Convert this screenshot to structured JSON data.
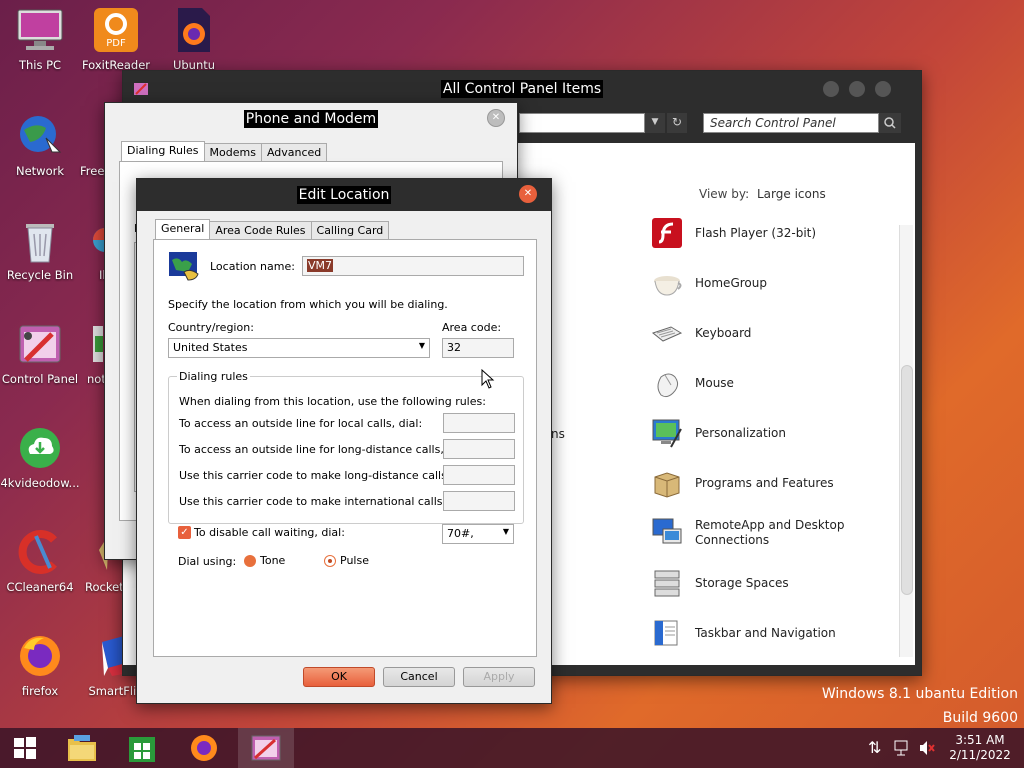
{
  "desktop_icons": [
    {
      "label": "This PC",
      "icon": "computer-icon"
    },
    {
      "label": "FoxitReader",
      "icon": "pdf-icon"
    },
    {
      "label": "Ubuntu",
      "icon": "firefox-file-icon"
    },
    {
      "label": "Network",
      "icon": "globe-icon"
    },
    {
      "label": "Free",
      "icon": "app-icon"
    },
    {
      "label": "Recycle Bin",
      "icon": "recycle-bin-icon"
    },
    {
      "label": "Il",
      "icon": "app-icon"
    },
    {
      "label": "Control Panel",
      "icon": "control-panel-icon"
    },
    {
      "label": "not",
      "icon": "app-icon"
    },
    {
      "label": "4kvideodow...",
      "icon": "download-icon"
    },
    {
      "label": "CCleaner64",
      "icon": "ccleaner-icon"
    },
    {
      "label": "Rocket",
      "icon": "app-icon"
    },
    {
      "label": "firefox",
      "icon": "firefox-icon"
    },
    {
      "label": "SmartFlip",
      "icon": "smartflip-icon"
    }
  ],
  "control_panel": {
    "title": "All Control Panel Items",
    "search_placeholder": "Search Control Panel",
    "view_by_label": "View by:",
    "view_by_value": "Large icons",
    "partial_text": "ns",
    "items": [
      {
        "label": "Flash Player (32-bit)",
        "icon": "flash-icon"
      },
      {
        "label": "HomeGroup",
        "icon": "homegroup-icon"
      },
      {
        "label": "Keyboard",
        "icon": "keyboard-icon"
      },
      {
        "label": "Mouse",
        "icon": "mouse-icon"
      },
      {
        "label": "Personalization",
        "icon": "personalization-icon"
      },
      {
        "label": "Programs and Features",
        "icon": "programs-icon"
      },
      {
        "label": "RemoteApp and Desktop",
        "label2": "Connections",
        "icon": "remoteapp-icon"
      },
      {
        "label": "Storage Spaces",
        "icon": "storage-icon"
      },
      {
        "label": "Taskbar and Navigation",
        "icon": "taskbar-icon"
      }
    ]
  },
  "phone_modem": {
    "title": "Phone and Modem",
    "tabs": [
      "Dialing Rules",
      "Modems",
      "Advanced"
    ],
    "partial_label": "L"
  },
  "edit_location": {
    "title": "Edit Location",
    "tabs": [
      "General",
      "Area Code Rules",
      "Calling Card"
    ],
    "location_name_label": "Location name:",
    "location_name_value": "VM7",
    "specify_text": "Specify the location from which you will be dialing.",
    "country_label": "Country/region:",
    "country_value": "United States",
    "area_code_label": "Area code:",
    "area_code_value": "32",
    "dialing_rules_group": "Dialing rules",
    "dialing_rules_intro": "When dialing from this location, use the following rules:",
    "rule_local": "To access an outside line for local calls, dial:",
    "rule_long": "To access an outside line for long-distance calls, dial:",
    "rule_carrier_long": "Use this carrier code to make long-distance calls:",
    "rule_carrier_intl": "Use this carrier code to make international calls:",
    "call_waiting_label": "To disable call waiting, dial:",
    "call_waiting_value": "70#,",
    "dial_using_label": "Dial using:",
    "tone_label": "Tone",
    "pulse_label": "Pulse",
    "ok_label": "OK",
    "cancel_label": "Cancel",
    "apply_label": "Apply"
  },
  "watermark": {
    "line1": "Windows 8.1 ubantu Edition",
    "line2": "Build 9600"
  },
  "taskbar": {
    "time": "3:51 AM",
    "date": "2/11/2022"
  }
}
